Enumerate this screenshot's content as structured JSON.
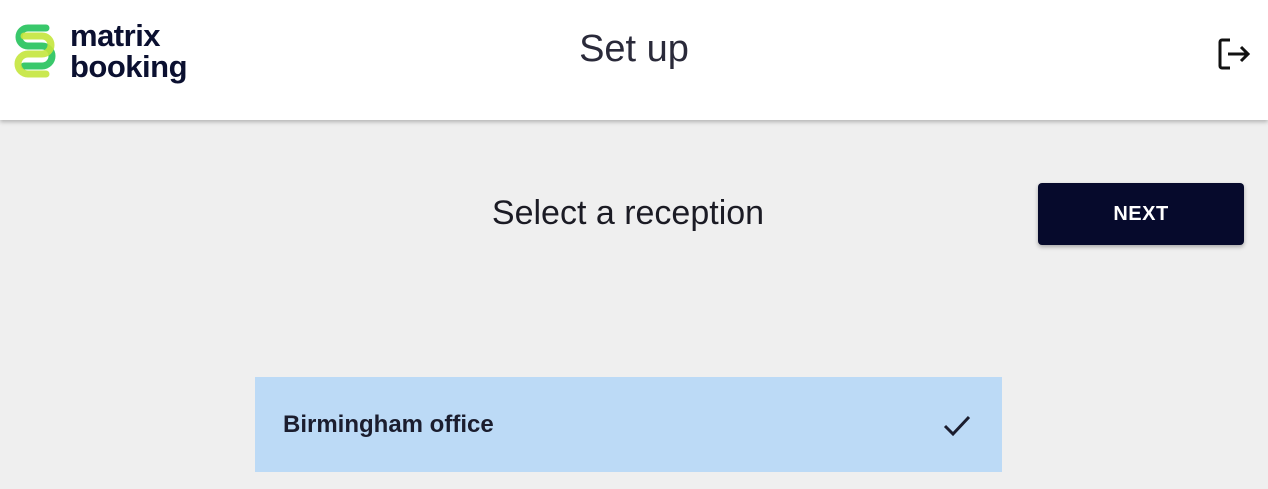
{
  "header": {
    "logo_line1": "matrix",
    "logo_line2": "booking",
    "title": "Set up",
    "icons": {
      "logo": "matrix-booking-logo-icon",
      "logout": "logout-icon"
    }
  },
  "main": {
    "title": "Select a reception",
    "next_label": "NEXT",
    "receptions": [
      {
        "label": "Birmingham office",
        "selected": true
      }
    ]
  },
  "colors": {
    "accent_dark": "#060a2c",
    "selected_row": "#bcdaf6",
    "logo_green": "#39c86b",
    "logo_lime": "#c4e63c",
    "background": "#efefef"
  }
}
